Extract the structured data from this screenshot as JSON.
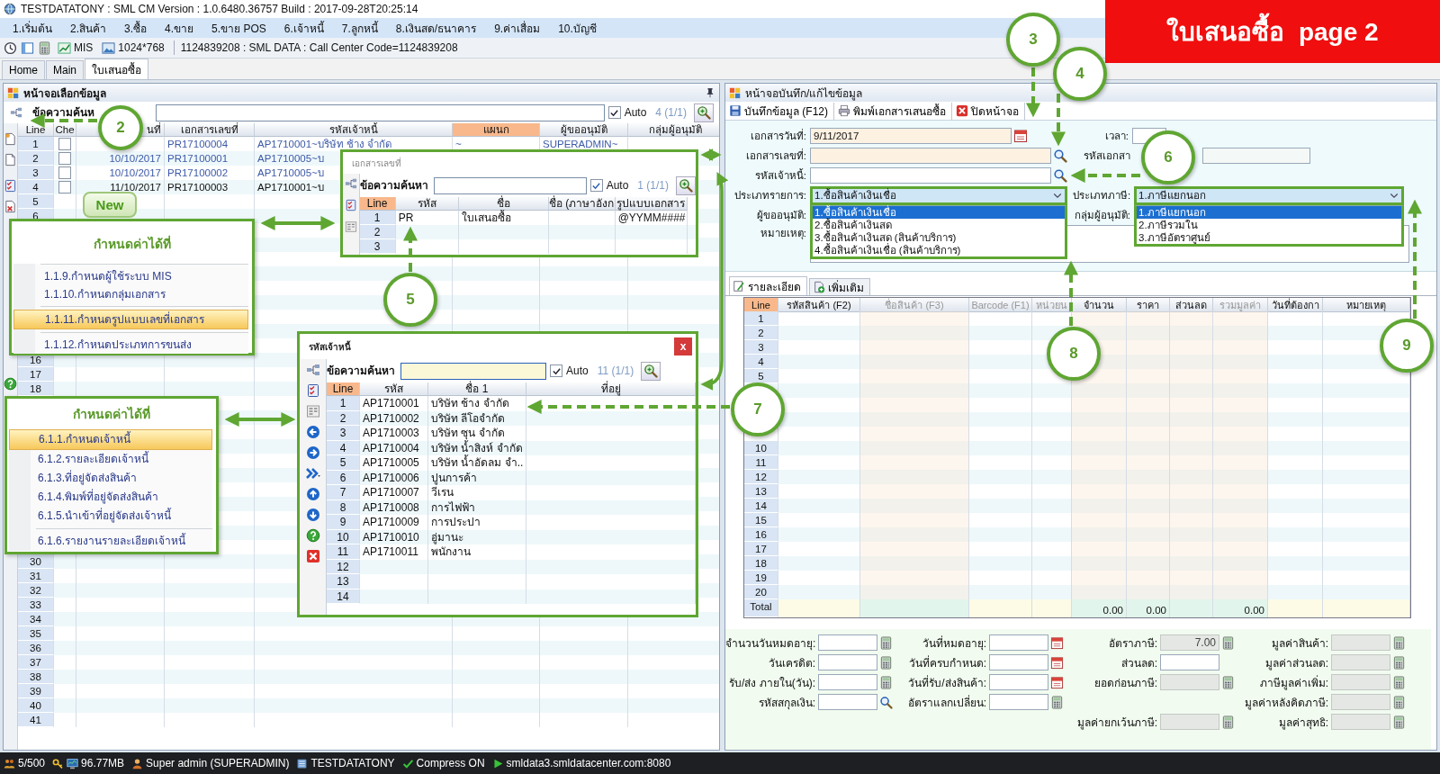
{
  "window": {
    "title": "TESTDATATONY : SML CM Version : 1.0.6480.36757  Build : 2017-09-28T20:25:14"
  },
  "banner": {
    "text": "ใบเสนอซื้อ  page 2"
  },
  "menu": [
    "1.เริ่มต้น",
    "2.สินค้า",
    "3.ซื้อ",
    "4.ขาย",
    "5.ขาย POS",
    "6.เจ้าหนี้",
    "7.ลูกหนี้",
    "8.เงินสด/ธนาคาร",
    "9.ค่าเสื่อม",
    "10.บัญชี"
  ],
  "toolbar": {
    "mis": "MIS",
    "resolution": "1024*768",
    "info": "1124839208 : SML DATA : Call Center Code=1124839208"
  },
  "tabs": [
    {
      "label": "Home",
      "selected": false
    },
    {
      "label": "Main",
      "selected": false
    },
    {
      "label": "ใบเสนอซื้อ",
      "selected": true
    }
  ],
  "left_panel": {
    "title": "หน้าจอเลือกข้อมูล",
    "search_label": "ข้อความค้นห",
    "auto": {
      "label": "Auto",
      "checked": true
    },
    "count": "4 (1/1)",
    "columns": [
      {
        "label": "Line",
        "sorted": false
      },
      {
        "label": "Che",
        "sorted": false
      },
      {
        "label": "นที่",
        "sorted": false
      },
      {
        "label": "เอกสารเลขที่",
        "sorted": false
      },
      {
        "label": "รหัสเจ้าหนี้",
        "sorted": false
      },
      {
        "label": "แผนก",
        "sorted": true
      },
      {
        "label": "ผู้ขออนุมัติ",
        "sorted": false
      },
      {
        "label": "กลุ่มผู้อนุมัติ",
        "sorted": false
      }
    ],
    "rows": [
      {
        "line": "1",
        "checked": false,
        "doc_no": "PR17100004",
        "creditor": "AP1710001~บริษัท ช้าง จำกัด",
        "dept": "~",
        "approver": "SUPERADMIN~",
        "color": "#3d5aa8"
      },
      {
        "line": "2",
        "checked": false,
        "date": "10/10/2017",
        "doc_no": "PR17100001",
        "creditor": "AP1710005~บ",
        "color": "#3d5aa8"
      },
      {
        "line": "3",
        "checked": false,
        "date": "10/10/2017",
        "doc_no": "PR17100002",
        "creditor": "AP1710005~บ",
        "color": "#3d5aa8"
      },
      {
        "line": "4",
        "checked": false,
        "date": "11/10/2017",
        "doc_no": "PR17100003",
        "creditor": "AP1710001~บ",
        "color": "#111111"
      }
    ],
    "line_blocks": [
      [
        "5",
        "6"
      ],
      [
        "16",
        "17",
        "18"
      ],
      [
        "30",
        "31",
        "32",
        "33",
        "34",
        "35",
        "36",
        "37",
        "38",
        "39",
        "40",
        "41"
      ]
    ]
  },
  "tooltip": "New",
  "doc_no_popup": {
    "title": "เอกสารเลขที่",
    "search_label": "ข้อความค้นหา",
    "auto": {
      "label": "Auto",
      "checked": true
    },
    "count": "1 (1/1)",
    "columns": [
      "Line",
      "รหัส",
      "ชื่อ",
      "ชื่อ (ภาษาอังก",
      "รูปแบบเอกสาร"
    ],
    "rows": [
      {
        "line": "1",
        "code": "PR",
        "name": "ใบเสนอซื้อ",
        "format": "@YYMM####"
      },
      {
        "line": "2"
      },
      {
        "line": "3"
      }
    ]
  },
  "creditor_popup": {
    "title": "รหัสเจ้าหนี้",
    "close": "x",
    "search_label": "ข้อความค้นหา",
    "auto": {
      "label": "Auto",
      "checked": true
    },
    "count": "11 (1/1)",
    "columns": [
      "Line",
      "รหัส",
      "ชื่อ 1",
      "ที่อยู่"
    ],
    "rows": [
      {
        "line": "1",
        "code": "AP1710001",
        "name": "บริษัท ช้าง จำกัด"
      },
      {
        "line": "2",
        "code": "AP1710002",
        "name": "บริษัท ลีโอจำกัด"
      },
      {
        "line": "3",
        "code": "AP1710003",
        "name": "บริษัท ซุน จำกัด"
      },
      {
        "line": "4",
        "code": "AP1710004",
        "name": "บริษัท น้ำสิงห์ จำกัด"
      },
      {
        "line": "5",
        "code": "AP1710005",
        "name": "บริษัท น้ำอัดลม จำ.."
      },
      {
        "line": "6",
        "code": "AP1710006",
        "name": "ปูนการค้า"
      },
      {
        "line": "7",
        "code": "AP1710007",
        "name": "วีเรน"
      },
      {
        "line": "8",
        "code": "AP1710008",
        "name": "การไฟฟ้า"
      },
      {
        "line": "9",
        "code": "AP1710009",
        "name": "การประปา"
      },
      {
        "line": "10",
        "code": "AP1710010",
        "name": "อู่มานะ"
      },
      {
        "line": "11",
        "code": "AP1710011",
        "name": "พนักงาน"
      },
      {
        "line": "12"
      },
      {
        "line": "13"
      },
      {
        "line": "14"
      }
    ]
  },
  "callouts": [
    {
      "title": "กำหนดค่าได้ที่",
      "groups": [
        [
          {
            "label": "1.1.9.กำหนดผู้ใช้ระบบ MIS",
            "selected": false
          },
          {
            "label": "1.1.10.กำหนดกลุ่มเอกสาร",
            "selected": false
          }
        ],
        [
          {
            "label": "1.1.11.กำหนดรูปแบบเลขที่เอกสาร",
            "selected": true
          }
        ],
        [
          {
            "label": "1.1.12.กำหนดประเภทการขนส่ง",
            "selected": false
          }
        ]
      ]
    },
    {
      "title": "กำหนดค่าได้ที่",
      "groups": [
        [
          {
            "label": "6.1.1.กำหนดเจ้าหนี้",
            "selected": true
          },
          {
            "label": "6.1.2.รายละเอียดเจ้าหนี้",
            "selected": false
          },
          {
            "label": "6.1.3.ที่อยู่จัดส่งสินค้า",
            "selected": false
          },
          {
            "label": "6.1.4.พิมพ์ที่อยู่จัดส่งสินค้า",
            "selected": false
          },
          {
            "label": "6.1.5.นำเข้าที่อยู่จัดส่งเจ้าหนี้",
            "selected": false
          }
        ],
        [
          {
            "label": "6.1.6.รายงานรายละเอียดเจ้าหนี้",
            "selected": false
          }
        ]
      ]
    }
  ],
  "steps": [
    "2",
    "3",
    "4",
    "5",
    "6",
    "7",
    "8",
    "9"
  ],
  "right_panel": {
    "title": "หน้าจอบันทึก/แก้ไขข้อมูล",
    "actions": [
      "บันทึกข้อมูล (F12)",
      "พิมพ์เอกสารเสนอซื้อ",
      "ปิดหน้าจอ"
    ],
    "form": {
      "doc_date": {
        "label": "เอกสารวันที่:",
        "value": "9/11/2017"
      },
      "time": {
        "label": "เวลา:"
      },
      "doc_no": {
        "label": "เอกสารเลขที่:"
      },
      "doc_code": {
        "label": "รหัสเอกสา"
      },
      "creditor": {
        "label": "รหัสเจ้าหนี้:"
      },
      "trans_type": {
        "label": "ประเภทรายการ:",
        "value": "1.ซื้อสินค้าเงินเชื่อ",
        "options": [
          {
            "label": "1.ซื้อสินค้าเงินเชื่อ",
            "selected": true
          },
          {
            "label": "2.ซื้อสินค้าเงินสด",
            "selected": false
          },
          {
            "label": "3.ซื้อสินค้าเงินสด (สินค้าบริการ)",
            "selected": false
          },
          {
            "label": "4.ซื้อสินค้าเงินเชื่อ (สินค้าบริการ)",
            "selected": false
          }
        ]
      },
      "tax_type": {
        "label": "ประเภทภาษี:",
        "value": "1.ภาษีแยกนอก",
        "options": [
          {
            "label": "1.ภาษีแยกนอก",
            "selected": true
          },
          {
            "label": "2.ภาษีรวมใน",
            "selected": false
          },
          {
            "label": "3.ภาษีอัตราศูนย์",
            "selected": false
          }
        ]
      },
      "approver": {
        "label": "ผู้ขออนุมัติ:"
      },
      "approver_group": {
        "label": "กลุ่มผู้อนุมัติ:"
      },
      "remark": {
        "label": "หมายเหตุ:"
      }
    },
    "detail_tabs": [
      {
        "label": "รายละเอียด",
        "selected": true
      },
      {
        "label": "เพิ่มเติม",
        "selected": false
      }
    ],
    "grid": {
      "columns": [
        {
          "label": "Line",
          "disabled": false
        },
        {
          "label": "รหัสสินค้า (F2)",
          "disabled": false
        },
        {
          "label": "ชื่อสินค้า (F3)",
          "disabled": true
        },
        {
          "label": "Barcode (F1)",
          "disabled": true
        },
        {
          "label": "หน่วยน",
          "disabled": true
        },
        {
          "label": "จำนวน",
          "disabled": false,
          "total": "0.00"
        },
        {
          "label": "ราคา",
          "disabled": false,
          "total": "0.00"
        },
        {
          "label": "ส่วนลด",
          "disabled": false
        },
        {
          "label": "รวมมูลค่า",
          "disabled": true,
          "total": "0.00"
        },
        {
          "label": "วันที่ต้องกา",
          "disabled": false
        },
        {
          "label": "หมายเหตุ",
          "disabled": false
        }
      ],
      "line_blocks": [
        [
          "1",
          "2",
          "3",
          "4",
          "5"
        ],
        [
          "10",
          "11",
          "12",
          "13",
          "14",
          "15",
          "16",
          "17",
          "18",
          "19",
          "20"
        ]
      ],
      "total_label": "Total"
    },
    "summary": [
      {
        "left": {
          "label": "จำนวนวันหมดอายุ:",
          "kind": "number",
          "readonly": false
        },
        "mid": {
          "label": "วันที่หมดอายุ:",
          "kind": "date",
          "readonly": false
        },
        "tax": {
          "label": "อัตราภาษี:",
          "kind": "number",
          "readonly": true,
          "value": "7.00"
        },
        "total": {
          "label": "มูลค่าสินค้า:",
          "kind": "number",
          "readonly": true
        }
      },
      {
        "left": {
          "label": "วันเครดิต:",
          "kind": "number",
          "readonly": false
        },
        "mid": {
          "label": "วันที่ครบกำหนด:",
          "kind": "date",
          "readonly": false
        },
        "tax": {
          "label": "ส่วนลด:",
          "kind": "text",
          "readonly": false
        },
        "total": {
          "label": "มูลค่าส่วนลด:",
          "kind": "number",
          "readonly": true
        }
      },
      {
        "left": {
          "label": "รับ/ส่ง ภายใน(วัน):",
          "kind": "number",
          "readonly": false
        },
        "mid": {
          "label": "วันที่รับ/ส่งสินค้า:",
          "kind": "date",
          "readonly": false
        },
        "tax": {
          "label": "ยอดก่อนภาษี:",
          "kind": "number",
          "readonly": true
        },
        "total": {
          "label": "ภาษีมูลค่าเพิ่ม:",
          "kind": "number",
          "readonly": true
        }
      },
      {
        "left": {
          "label": "รหัสสกุลเงิน:",
          "kind": "lookup",
          "readonly": false
        },
        "mid": {
          "label": "อัตราแลกเปลี่ยน:",
          "kind": "number",
          "readonly": false
        },
        "total": {
          "label": "มูลค่าหลังคิดภาษี:",
          "kind": "number",
          "readonly": true
        }
      },
      {
        "tax": {
          "label": "มูลค่ายกเว้นภาษี:",
          "kind": "number",
          "readonly": true
        },
        "total": {
          "label": "มูลค่าสุทธิ:",
          "kind": "number",
          "readonly": true
        }
      }
    ]
  },
  "status_bar": [
    "5/500",
    "96.77MB",
    "Super admin (SUPERADMIN)",
    "TESTDATATONY",
    "Compress ON",
    "smldata3.smldatacenter.com:8080"
  ]
}
